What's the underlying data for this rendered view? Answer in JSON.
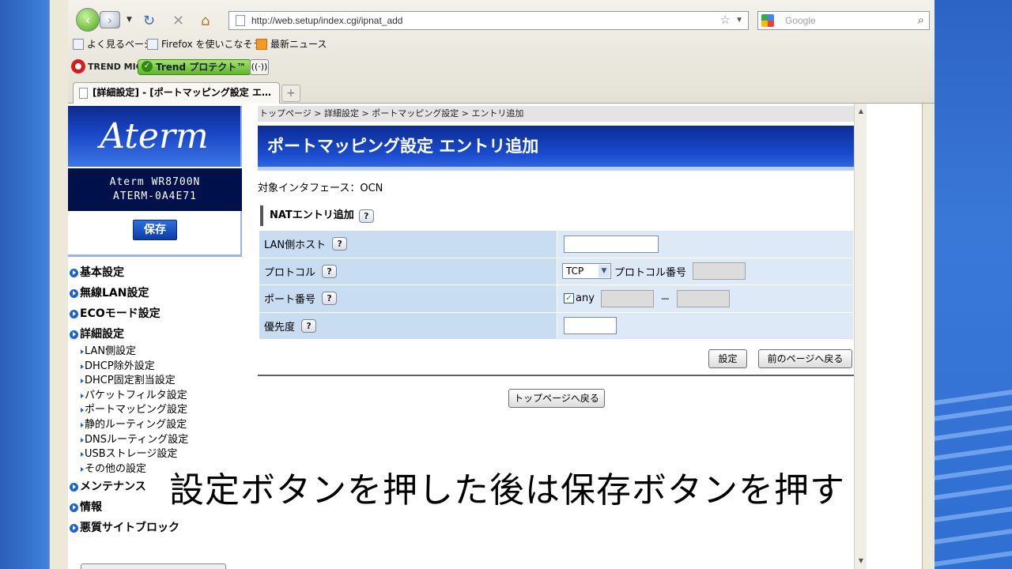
{
  "browser": {
    "url": "http://web.setup/index.cgi/ipnat_add",
    "search_placeholder": "Google",
    "bookmarks": [
      "よく見るページ",
      "Firefox を使いこなそう",
      "最新ニュース"
    ],
    "trend_logo": "TREND MICRO",
    "trend_protect": "Trend プロテクト™",
    "tab_title": "[詳細設定] - [ポートマッピング設定 エ…",
    "new_tab": "+"
  },
  "sidebar": {
    "logo": "Aterm",
    "model": "Aterm WR8700N",
    "device_id": "ATERM-0A4E71",
    "save_label": "保存",
    "menu": [
      {
        "label": "基本設定"
      },
      {
        "label": "無線LAN設定"
      },
      {
        "label": "ECOモード設定"
      },
      {
        "label": "詳細設定"
      }
    ],
    "submenu": [
      "LAN側設定",
      "DHCP除外設定",
      "DHCP固定割当設定",
      "パケットフィルタ設定",
      "ポートマッピング設定",
      "静的ルーティング設定",
      "DNSルーティング設定",
      "USBストレージ設定",
      "その他の設定"
    ],
    "menu_bottom": [
      {
        "label": "メンテナンス"
      },
      {
        "label": "情報"
      },
      {
        "label": "悪質サイトブロック"
      }
    ]
  },
  "main": {
    "breadcrumb": "トップページ > 詳細設定 > ポートマッピング設定 > エントリ追加",
    "title": "ポートマッピング設定 エントリ追加",
    "interface": "対象インタフェース：OCN",
    "section": "NATエントリ追加",
    "help": "?",
    "rows": {
      "lan_host": "LAN側ホスト",
      "protocol": "プロトコル",
      "protocol_value": "TCP",
      "protocol_number": "プロトコル番号",
      "port": "ポート番号",
      "port_any": "any",
      "port_dash": "－",
      "priority": "優先度"
    },
    "set_button": "設定",
    "back_button": "前のページへ戻る",
    "top_button": "トップページへ戻る"
  },
  "caption": "設定ボタンを押した後は保存ボタンを押す",
  "colors": {
    "title_blue": "#1a4ccf",
    "table_label_bg": "#c8dcf2",
    "table_value_bg": "#dde9f6"
  }
}
